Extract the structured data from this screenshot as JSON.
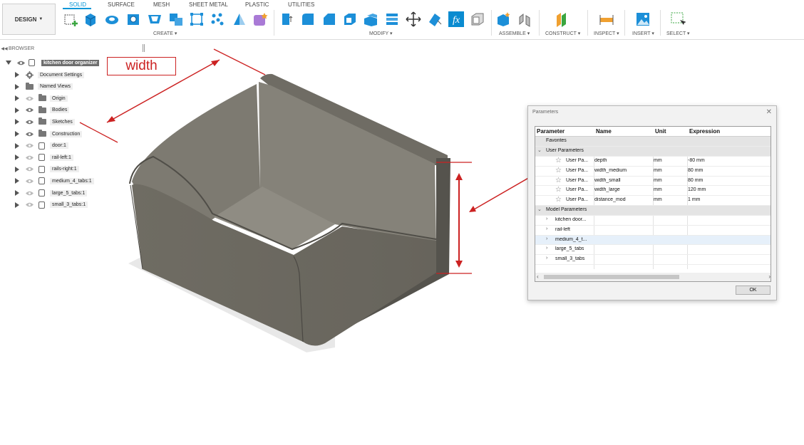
{
  "toolbar": {
    "design_label": "DESIGN",
    "tabs": [
      "SOLID",
      "SURFACE",
      "MESH",
      "SHEET METAL",
      "PLASTIC",
      "UTILITIES"
    ],
    "groups": {
      "create": "CREATE",
      "modify": "MODIFY",
      "assemble": "ASSEMBLE",
      "construct": "CONSTRUCT",
      "inspect": "INSPECT",
      "insert": "INSERT",
      "select": "SELECT"
    },
    "colors": {
      "accent": "#0696d7",
      "icon_blue": "#1c8fd8",
      "icon_orange": "#f0a030"
    }
  },
  "browser": {
    "title": "BROWSER",
    "root": "kitchen door organizer",
    "items": [
      {
        "label": "Document Settings",
        "icon": "gear-icon"
      },
      {
        "label": "Named Views",
        "icon": "folder-icon"
      },
      {
        "label": "Origin",
        "icon": "folder-icon"
      },
      {
        "label": "Bodies",
        "icon": "folder-icon"
      },
      {
        "label": "Sketches",
        "icon": "folder-icon"
      },
      {
        "label": "Construction",
        "icon": "folder-icon"
      },
      {
        "label": "door:1",
        "icon": "component-icon"
      },
      {
        "label": "rail-left:1",
        "icon": "component-icon"
      },
      {
        "label": "rails-right:1",
        "icon": "component-icon"
      },
      {
        "label": "medium_4_tabs:1",
        "icon": "component-icon"
      },
      {
        "label": "large_5_tabs:1",
        "icon": "component-icon"
      },
      {
        "label": "small_3_tabs:1",
        "icon": "component-icon"
      }
    ]
  },
  "annotation": {
    "width_label": "width",
    "color": "#cc2222"
  },
  "parameters_dialog": {
    "title": "Parameters",
    "columns": [
      "Parameter",
      "Name",
      "Unit",
      "Expression"
    ],
    "favorites_label": "Favorites",
    "user_section": "User Parameters",
    "user_params": [
      {
        "parameter": "User Pa...",
        "name": "depth",
        "unit": "mm",
        "expression": "-80 mm"
      },
      {
        "parameter": "User Pa...",
        "name": "width_medium",
        "unit": "mm",
        "expression": "80 mm"
      },
      {
        "parameter": "User Pa...",
        "name": "width_small",
        "unit": "mm",
        "expression": "80 mm"
      },
      {
        "parameter": "User Pa...",
        "name": "width_large",
        "unit": "mm",
        "expression": "120 mm"
      },
      {
        "parameter": "User Pa...",
        "name": "distance_mod",
        "unit": "mm",
        "expression": "1 mm"
      }
    ],
    "model_section": "Model Parameters",
    "model_params": [
      "kitchen door...",
      "rail-left",
      "medium_4_t...",
      "large_5_tabs",
      "small_3_tabs"
    ],
    "ok_label": "OK"
  }
}
